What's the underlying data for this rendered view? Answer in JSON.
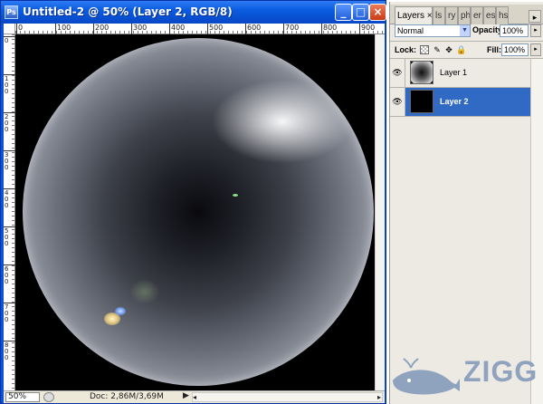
{
  "document_window": {
    "app_icon_label": "Ps",
    "title": "Untitled-2 @ 50% (Layer 2, RGB/8)",
    "ruler_top_labels": [
      "0",
      "100",
      "200",
      "300",
      "400",
      "500",
      "600",
      "700",
      "800",
      "900"
    ],
    "ruler_left_labels": [
      "0",
      "100",
      "200",
      "300",
      "400",
      "500",
      "600",
      "700",
      "800"
    ],
    "status": {
      "zoom": "50%",
      "doc_info": "Doc: 2,86M/3,69M",
      "arrow": "▶"
    }
  },
  "layers_palette": {
    "tabs": [
      "Layers",
      "ls",
      "ry",
      "ph",
      "er",
      "es",
      "hs"
    ],
    "tab_close": "×",
    "blend_mode": "Normal",
    "opacity_label": "Opacity:",
    "opacity_value": "100%",
    "lock_label": "Lock:",
    "fill_label": "Fill:",
    "fill_value": "100%",
    "layers": [
      {
        "name": "Layer 1",
        "visible": true,
        "selected": false
      },
      {
        "name": "Layer 2",
        "visible": true,
        "selected": true
      }
    ]
  },
  "watermark": {
    "text": "ZIGG"
  },
  "colors": {
    "title_bar": "#0a5ce0",
    "selected_layer": "#316ac5",
    "canvas_background": "#000000"
  }
}
